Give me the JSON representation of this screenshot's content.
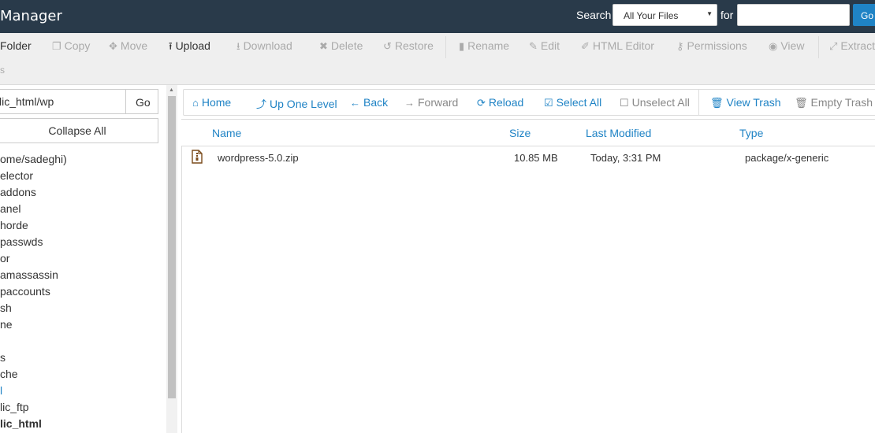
{
  "header": {
    "title": "Manager",
    "search_label": "Search",
    "search_scope": "All Your Files",
    "for_label": "for",
    "search_value": "",
    "go_label": "Go"
  },
  "toolbar": {
    "folder": "Folder",
    "copy": "Copy",
    "move": "Move",
    "upload": "Upload",
    "download": "Download",
    "delete": "Delete",
    "restore": "Restore",
    "rename": "Rename",
    "edit": "Edit",
    "html_editor": "HTML Editor",
    "permissions": "Permissions",
    "view": "View",
    "extract": "Extract",
    "sub_fragment": "s"
  },
  "left_pane": {
    "path_value": "lic_html/wp",
    "go_label": "Go",
    "collapse_label": "Collapse All",
    "tree": [
      "ome/sadeghi)",
      "elector",
      "addons",
      "anel",
      "horde",
      "passwds",
      "or",
      "amassassin",
      "paccounts",
      "sh",
      "ne",
      "",
      "s",
      "che",
      "l",
      "lic_ftp",
      "lic_html"
    ]
  },
  "nav": {
    "home": "Home",
    "up_one_level": "Up One Level",
    "back": "Back",
    "forward": "Forward",
    "reload": "Reload",
    "select_all": "Select All",
    "unselect_all": "Unselect All",
    "view_trash": "View Trash",
    "empty_trash": "Empty Trash"
  },
  "table": {
    "columns": [
      "Name",
      "Size",
      "Last Modified",
      "Type"
    ],
    "rows": [
      {
        "name": "wordpress-5.0.zip",
        "size": "10.85 MB",
        "modified": "Today, 3:31 PM",
        "type": "package/x-generic",
        "icon": "archive-file-icon"
      }
    ]
  },
  "colors": {
    "header_bg": "#293a4a",
    "accent": "#1f83c5",
    "toolbar_bg": "#efefef"
  }
}
